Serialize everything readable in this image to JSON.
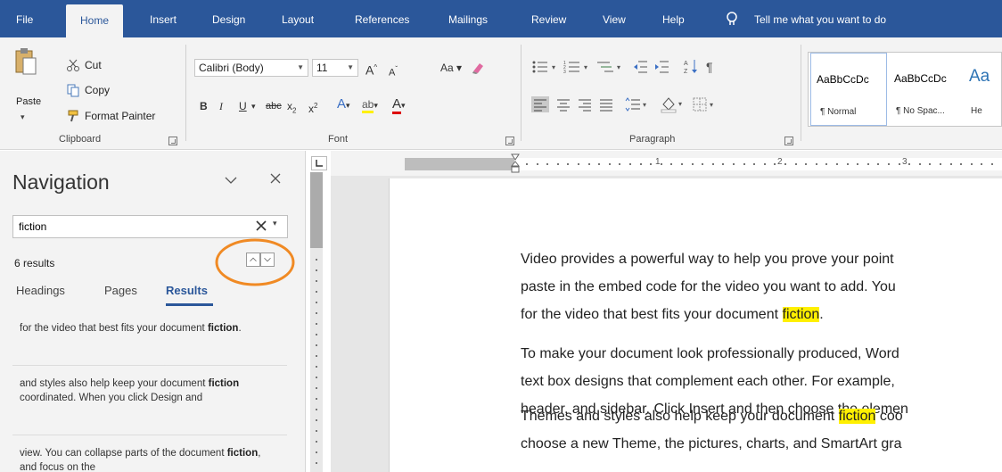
{
  "ribbon": {
    "tabs": [
      "File",
      "Home",
      "Insert",
      "Design",
      "Layout",
      "References",
      "Mailings",
      "Review",
      "View",
      "Help"
    ],
    "active_tab": "Home",
    "tell_me": "Tell me what you want to do",
    "colors": {
      "tab_bar": "#2b579a",
      "ribbon_bg": "#f3f3f3",
      "accent": "#2b579a"
    },
    "clipboard": {
      "paste": "Paste",
      "cut": "Cut",
      "copy": "Copy",
      "format_painter": "Format Painter",
      "group_label": "Clipboard"
    },
    "font": {
      "font_name": "Calibri (Body)",
      "font_size": "11",
      "change_case": "Aa",
      "bold": "B",
      "italic": "I",
      "underline": "U",
      "strikethrough": "abc",
      "subscript": "x",
      "superscript": "x",
      "group_label": "Font"
    },
    "paragraph": {
      "group_label": "Paragraph"
    },
    "styles": [
      {
        "sample": "AaBbCcDc",
        "name": "¶ Normal"
      },
      {
        "sample": "AaBbCcDc",
        "name": "¶ No Spac..."
      },
      {
        "sample": "Aa",
        "name": "He"
      }
    ]
  },
  "navigation": {
    "title": "Navigation",
    "search_value": "fiction",
    "results_count": "6 results",
    "tabs": [
      "Headings",
      "Pages",
      "Results"
    ],
    "active_tab": "Results",
    "highlight_color": "#f08a24",
    "results": [
      {
        "before": "for the video that best fits your document ",
        "hit": "fiction",
        "after": "."
      },
      {
        "before": "and styles also help keep your document ",
        "hit": "fiction",
        "after": " coordinated. When you click Design and"
      },
      {
        "before": "view. You can collapse parts of the document ",
        "hit": "fiction",
        "after": ", and focus on the"
      }
    ]
  },
  "ruler": {
    "numbers": [
      "1",
      "2",
      "3"
    ]
  },
  "document": {
    "paragraphs": [
      [
        [
          {
            "t": "Video provides a powerful way to help you prove your point"
          }
        ],
        [
          {
            "t": "paste in the embed code for the video you want to add. You"
          }
        ],
        [
          {
            "t": "for the video that best fits your document "
          },
          {
            "t": "fiction",
            "mark": true
          },
          {
            "t": "."
          }
        ]
      ],
      [
        [
          {
            "t": "To make your document look professionally produced, Word"
          }
        ],
        [
          {
            "t": "text box designs that complement each other. For example, "
          }
        ],
        [
          {
            "t": "header, and sidebar. Click Insert and then choose the elemen"
          }
        ]
      ],
      [
        [
          {
            "t": "Themes and styles also help keep your document "
          },
          {
            "t": "fiction",
            "mark": true
          },
          {
            "t": " coo"
          }
        ],
        [
          {
            "t": "choose a new Theme, the pictures, charts, and SmartArt gra"
          }
        ]
      ]
    ],
    "highlight_color": "#fff000"
  }
}
